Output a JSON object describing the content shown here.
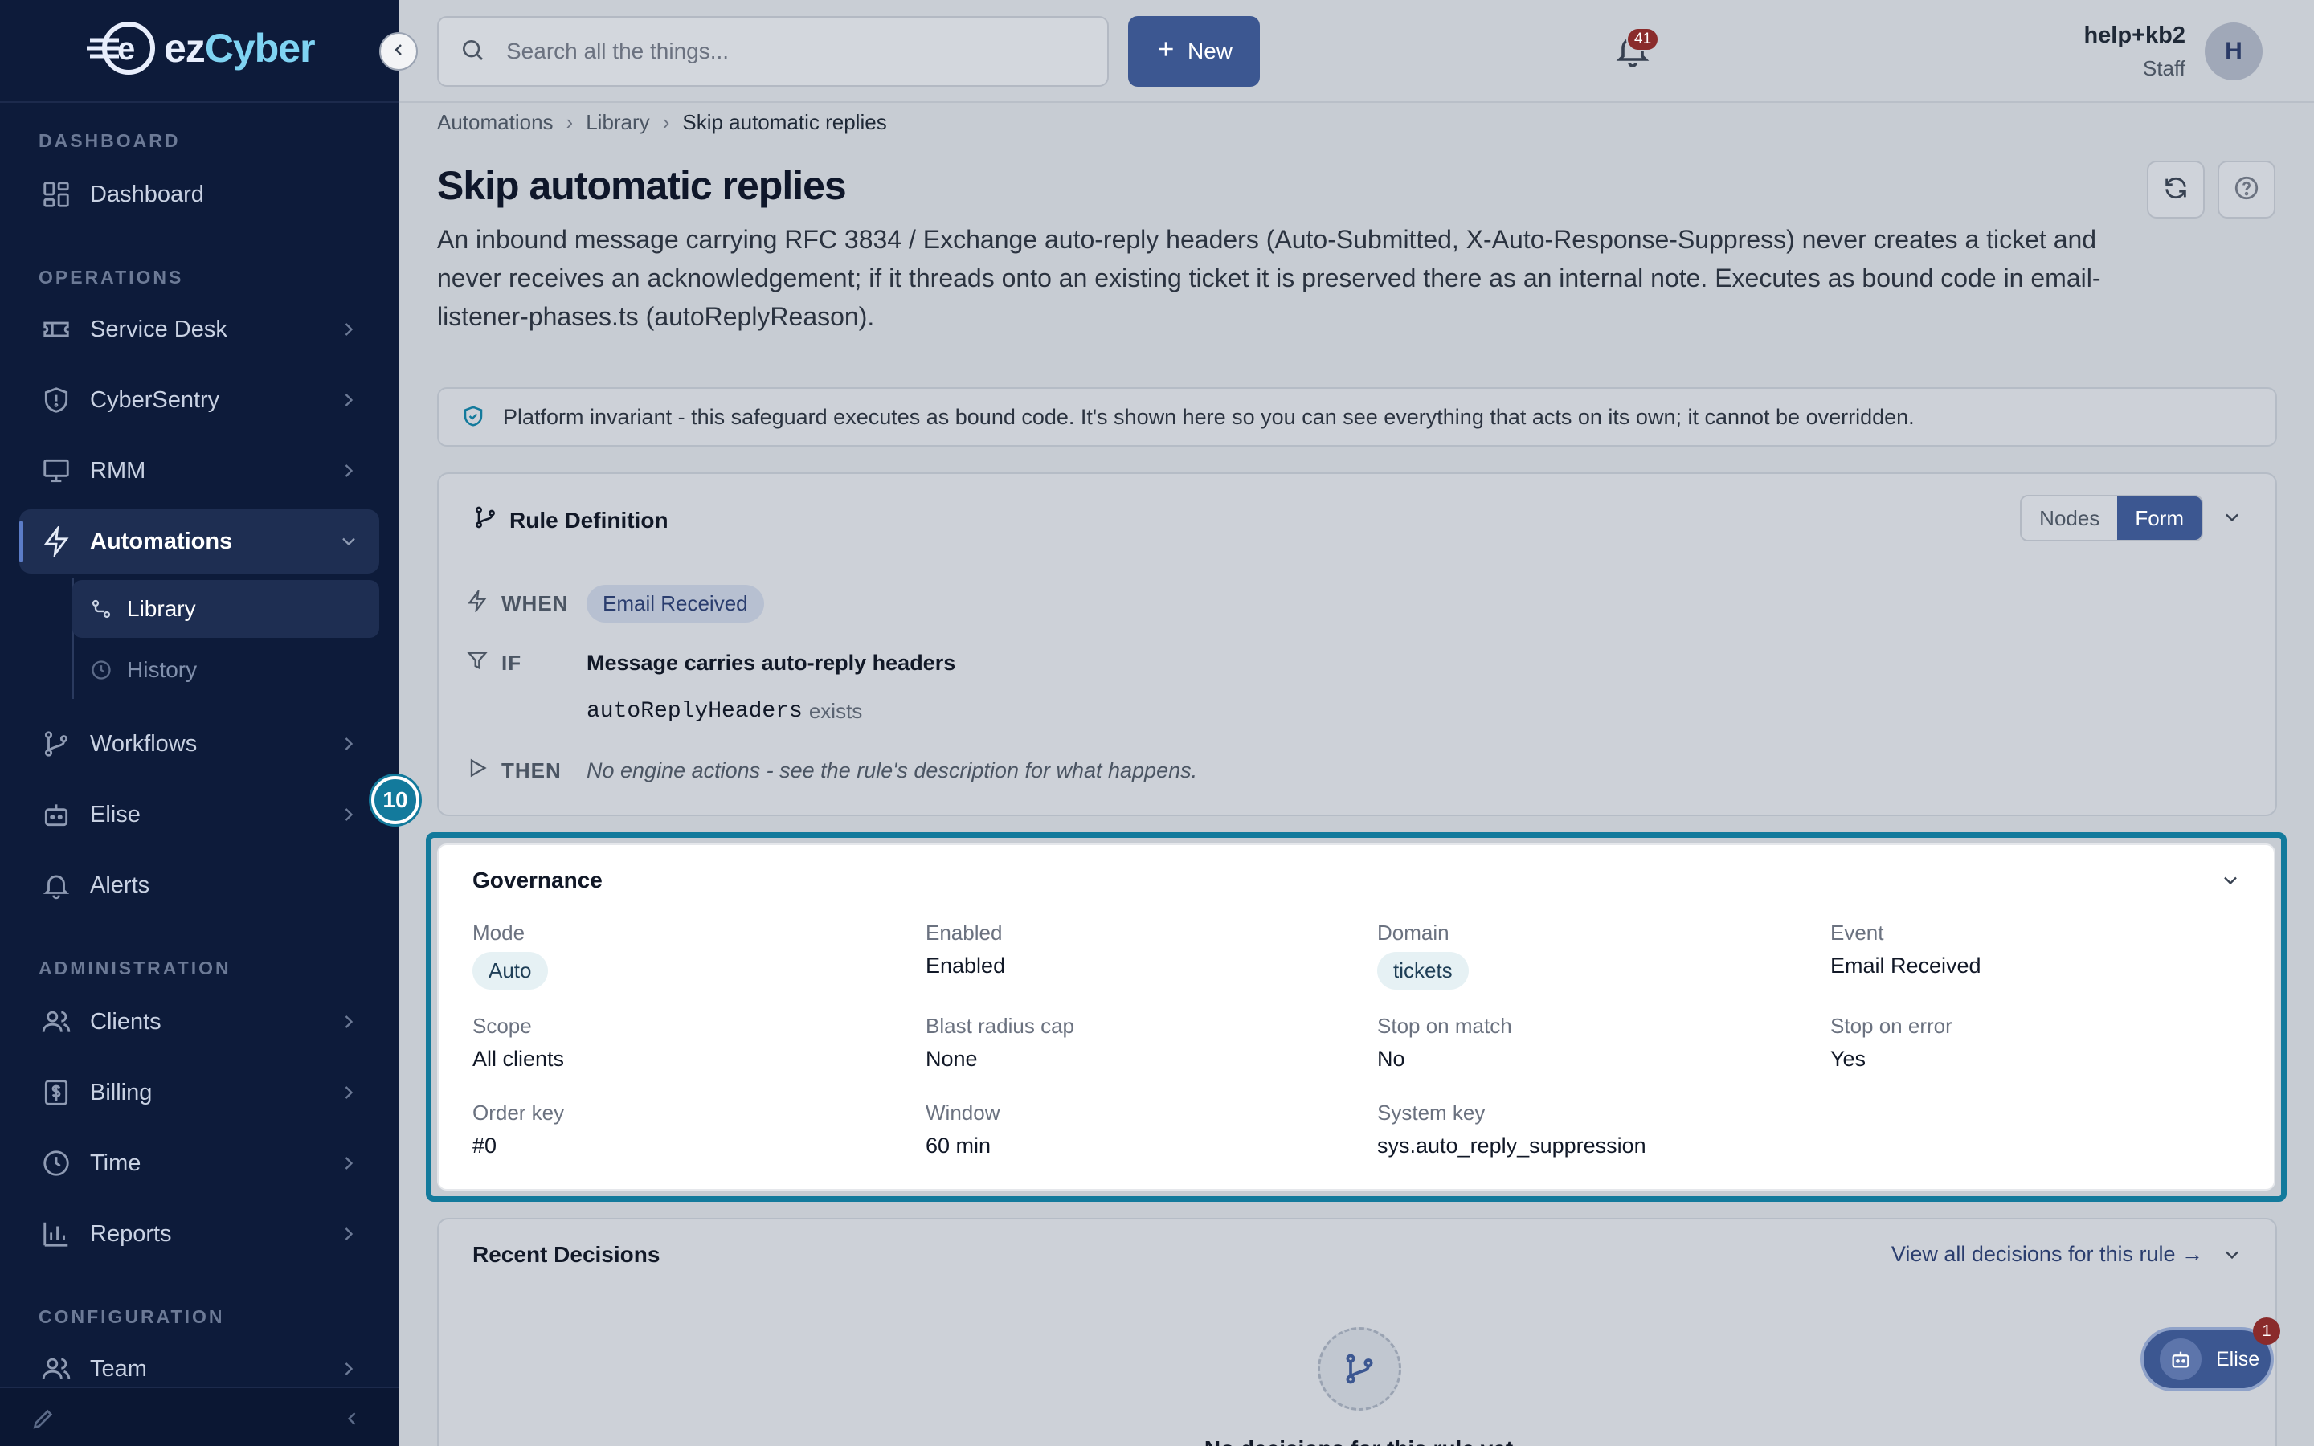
{
  "app": {
    "brand_e": "e",
    "brand_ez": "ez",
    "brand_cyber": "Cyber"
  },
  "sidebar": {
    "sections": {
      "dashboard": "DASHBOARD",
      "operations": "OPERATIONS",
      "administration": "ADMINISTRATION",
      "configuration": "CONFIGURATION"
    },
    "items": {
      "dashboard": "Dashboard",
      "service_desk": "Service Desk",
      "cybersentry": "CyberSentry",
      "rmm": "RMM",
      "automations": "Automations",
      "library": "Library",
      "history": "History",
      "workflows": "Workflows",
      "elise": "Elise",
      "alerts": "Alerts",
      "clients": "Clients",
      "billing": "Billing",
      "time": "Time",
      "reports": "Reports",
      "team": "Team"
    },
    "step_badge": "10"
  },
  "topbar": {
    "search_placeholder": "Search all the things...",
    "new_label": "New",
    "notification_count": "41",
    "user_name": "help+kb2",
    "user_role": "Staff",
    "avatar_initial": "H"
  },
  "breadcrumb": [
    "Automations",
    "Library",
    "Skip automatic replies"
  ],
  "page": {
    "title": "Skip automatic replies",
    "description": "An inbound message carrying RFC 3834 / Exchange auto-reply headers (Auto-Submitted, X-Auto-Response-Suppress) never creates a ticket and never receives an acknowledgement; if it threads onto an existing ticket it is preserved there as an internal note. Executes as bound code in email-listener-phases.ts (autoReplyReason).",
    "notice": "Platform invariant - this safeguard executes as bound code. It's shown here so you can see everything that acts on its own; it cannot be overridden."
  },
  "rule_definition": {
    "title": "Rule Definition",
    "view_nodes": "Nodes",
    "view_form": "Form",
    "when_label": "WHEN",
    "when_value": "Email Received",
    "if_label": "IF",
    "if_title": "Message carries auto-reply headers",
    "if_field": "autoReplyHeaders",
    "if_op": "exists",
    "then_label": "THEN",
    "then_value": "No engine actions - see the rule's description for what happens."
  },
  "governance": {
    "title": "Governance",
    "mode_label": "Mode",
    "mode_value": "Auto",
    "enabled_label": "Enabled",
    "enabled_value": "Enabled",
    "domain_label": "Domain",
    "domain_value": "tickets",
    "event_label": "Event",
    "event_value": "Email Received",
    "scope_label": "Scope",
    "scope_value": "All clients",
    "blast_label": "Blast radius cap",
    "blast_value": "None",
    "stop_match_label": "Stop on match",
    "stop_match_value": "No",
    "stop_error_label": "Stop on error",
    "stop_error_value": "Yes",
    "order_label": "Order key",
    "order_value": "#0",
    "window_label": "Window",
    "window_value": "60 min",
    "system_key_label": "System key",
    "system_key_value": "sys.auto_reply_suppression"
  },
  "recent_decisions": {
    "title": "Recent Decisions",
    "view_all": "View all decisions for this rule →",
    "empty_text": "No decisions for this rule yet"
  },
  "elise_fab": {
    "label": "Elise",
    "badge": "1"
  },
  "colors": {
    "sidebar_bg": "#0d1b3a",
    "accent": "#3c5791",
    "highlight": "#137a9c"
  }
}
